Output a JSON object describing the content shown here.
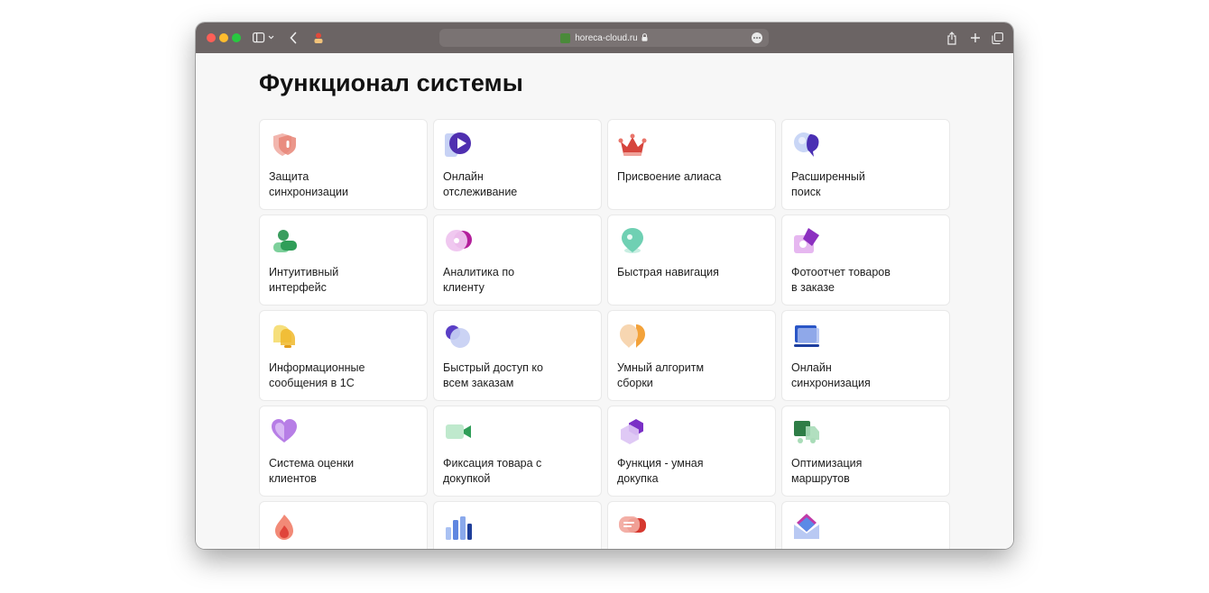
{
  "browser": {
    "url": "horeca-cloud.ru"
  },
  "page": {
    "title": "Функционал системы"
  },
  "features": [
    {
      "label": "Защита\nсинхронизации",
      "icon": "shield-icon"
    },
    {
      "label": "Онлайн\nотслеживание",
      "icon": "play-icon"
    },
    {
      "label": "Присвоение алиаса",
      "icon": "crown-icon"
    },
    {
      "label": "Расширенный\nпоиск",
      "icon": "search-bubble-icon"
    },
    {
      "label": "Интуитивный\nинтерфейс",
      "icon": "user-icon"
    },
    {
      "label": "Аналитика по\nклиенту",
      "icon": "analytics-icon"
    },
    {
      "label": "Быстрая навигация",
      "icon": "location-pin-icon"
    },
    {
      "label": "Фотоотчет товаров\nв заказе",
      "icon": "photo-icon"
    },
    {
      "label": "Информационные\nсообщения в 1С",
      "icon": "bell-icon"
    },
    {
      "label": "Быстрый доступ ко\nвсем заказам",
      "icon": "access-icon"
    },
    {
      "label": "Умный алгоритм\nсборки",
      "icon": "algorithm-icon"
    },
    {
      "label": "Онлайн\nсинхронизация",
      "icon": "laptop-icon"
    },
    {
      "label": "Система оценки\nклиентов",
      "icon": "heart-icon"
    },
    {
      "label": "Фиксация товара с\nдокупкой",
      "icon": "camera-icon"
    },
    {
      "label": "Функция - умная\nдокупка",
      "icon": "hexagon-icon"
    },
    {
      "label": "Оптимизация\nмаршрутов",
      "icon": "truck-icon"
    },
    {
      "label": "",
      "icon": "flame-icon"
    },
    {
      "label": "",
      "icon": "bar-chart-icon"
    },
    {
      "label": "",
      "icon": "chat-icon"
    },
    {
      "label": "",
      "icon": "envelope-icon"
    }
  ]
}
